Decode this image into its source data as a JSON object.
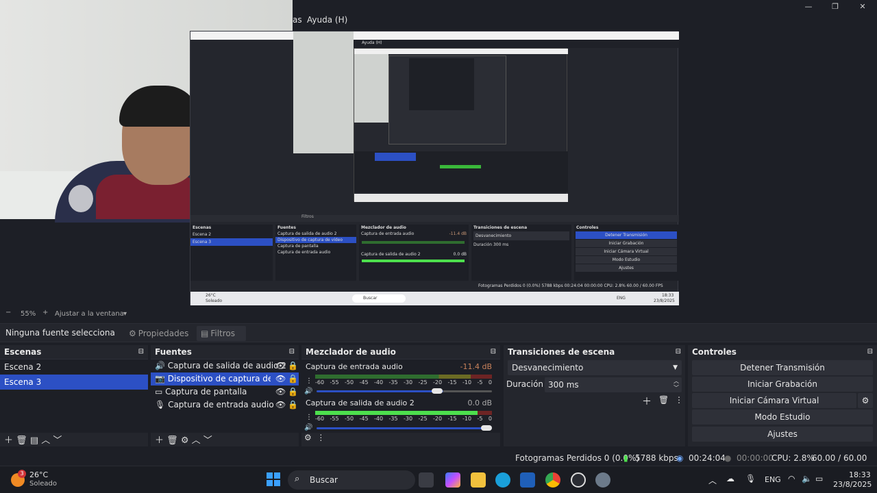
{
  "window": {
    "minimize_icon": "minimize-icon",
    "restore_icon": "restore-icon",
    "close_icon": "close-icon",
    "min_glyph": "—",
    "restore_glyph": "❐",
    "close_glyph": "✕"
  },
  "menu": {
    "partial": "as",
    "help": "Ayuda (H)"
  },
  "zoom": {
    "minus": "−",
    "value": "55%",
    "plus": "+",
    "fit": "Ajustar a la ventana",
    "arrow": "▾"
  },
  "props": {
    "no_source": "Ninguna fuente selecciona",
    "properties": "Propiedades",
    "filters": "Filtros"
  },
  "scenes": {
    "title": "Escenas",
    "items": [
      {
        "label": "Escena 2"
      },
      {
        "label": "Escena 3"
      }
    ]
  },
  "sources": {
    "title": "Fuentes",
    "items": [
      {
        "label": "Captura de salida de audio 2",
        "icon": "speaker-icon"
      },
      {
        "label": "Dispositivo de captura de vídeo",
        "icon": "camera-icon"
      },
      {
        "label": "Captura de pantalla",
        "icon": "monitor-icon"
      },
      {
        "label": "Captura de entrada audio",
        "icon": "microphone-icon"
      }
    ]
  },
  "mixer": {
    "title": "Mezclador de audio",
    "channels": [
      {
        "name": "Captura de entrada audio",
        "db": "-11.4 dB",
        "level": 0.0,
        "volume": 0.72
      },
      {
        "name": "Captura de salida de audio 2",
        "db": "0.0 dB",
        "level": 0.92,
        "volume": 1.0
      }
    ],
    "scale": [
      "-60",
      "-55",
      "-50",
      "-45",
      "-40",
      "-35",
      "-30",
      "-25",
      "-20",
      "-15",
      "-10",
      "-5",
      "0"
    ]
  },
  "transitions": {
    "title": "Transiciones de escena",
    "selected": "Desvanecimiento",
    "duration_label": "Duración",
    "duration_value": "300 ms"
  },
  "controls": {
    "title": "Controles",
    "stop_stream": "Detener Transmisión",
    "start_rec": "Iniciar Grabación",
    "virtual_cam": "Iniciar Cámara Virtual",
    "studio": "Modo Estudio",
    "settings": "Ajustes"
  },
  "status": {
    "frames": "Fotogramas Perdidos 0 (0.0%)",
    "kbps": "5788 kbps",
    "stream_time": "00:24:04",
    "rec_time": "00:00:00",
    "cpu": "CPU: 2.8%",
    "fps": "60.00 / 60.00 FPS"
  },
  "taskbar": {
    "weather_temp": "26°C",
    "weather_desc": "Soleado",
    "badge": "3",
    "search": "Buscar",
    "lang": "ENG",
    "time": "18:33",
    "date": "23/8/2025"
  },
  "nested": {
    "help": "Ayuda (H)",
    "scenes_title": "Escenas",
    "scene1": "Escena 2",
    "scene2": "Escena 3",
    "sources_title": "Fuentes",
    "src1": "Captura de salida de audio 2",
    "src2": "Dispositivo de captura de vídeo",
    "src3": "Captura de pantalla",
    "src4": "Captura de entrada audio",
    "mixer_title": "Mezclador de audio",
    "ch1": "Captura de entrada audio",
    "ch1db": "-11.4 dB",
    "ch2": "Captura de salida de audio 2",
    "ch2db": "0.0 dB",
    "trans_title": "Transiciones de escena",
    "trans": "Desvanecimiento",
    "dur": "Duración",
    "durv": "300 ms",
    "ctrl_title": "Controles",
    "c1": "Detener Transmisión",
    "c2": "Iniciar Grabación",
    "c3": "Iniciar Cámara Virtual",
    "c4": "Modo Estudio",
    "c5": "Ajustes",
    "status": "Fotogramas Perdidos 0 (0.0%)   5788 kbps   00:24:04   00:00:00   CPU: 2.8%   60.00 / 60.00 FPS",
    "filters": "Filtros",
    "search": "Buscar",
    "lang": "ENG",
    "time": "18:33",
    "date": "23/8/2025",
    "weather": "26°C",
    "weather_desc": "Soleado"
  }
}
